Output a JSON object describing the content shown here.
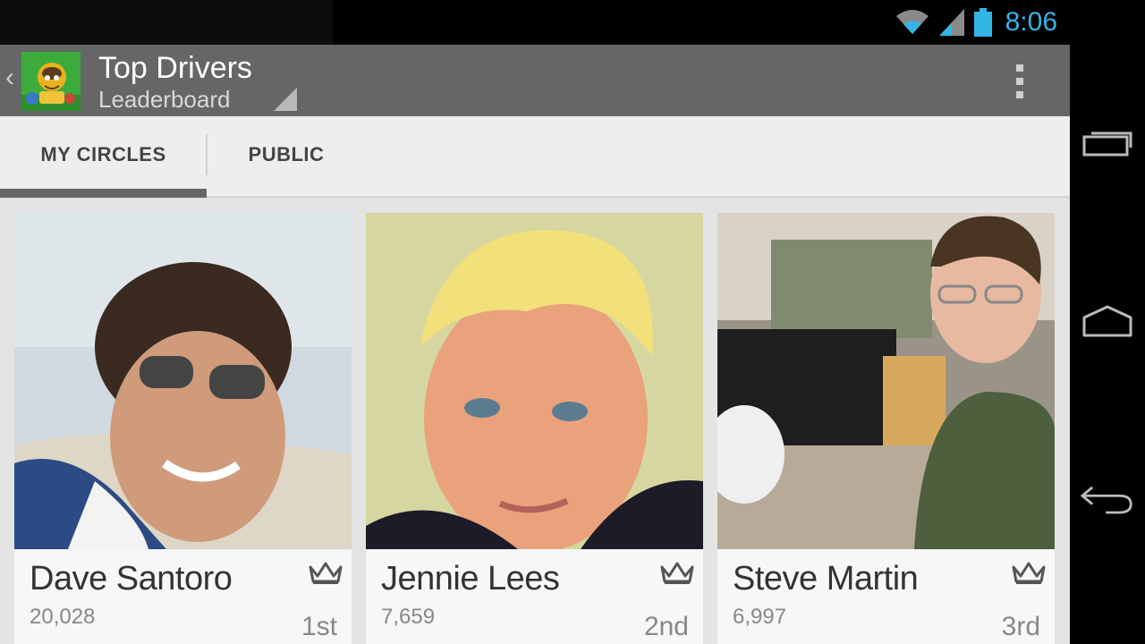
{
  "status_bar": {
    "time": "8:06"
  },
  "action_bar": {
    "title": "Top Drivers",
    "subtitle": "Leaderboard",
    "app_icon": "turtle-driver-app-icon",
    "overflow_icon": "overflow-menu-icon"
  },
  "tabs": [
    {
      "label": "MY CIRCLES",
      "selected": true
    },
    {
      "label": "PUBLIC",
      "selected": false
    }
  ],
  "leaderboard": [
    {
      "name": "Dave Santoro",
      "score": "20,028",
      "rank": "1st",
      "badge_icon": "crown-icon"
    },
    {
      "name": "Jennie Lees",
      "score": "7,659",
      "rank": "2nd",
      "badge_icon": "crown-icon"
    },
    {
      "name": "Steve Martin",
      "score": "6,997",
      "rank": "3rd",
      "badge_icon": "crown-icon"
    }
  ],
  "nav_bar": {
    "icons": [
      "recent-apps-icon",
      "home-icon",
      "back-icon"
    ]
  },
  "colors": {
    "action_bar": "#666666",
    "status_accent": "#33b5e5",
    "tab_bar": "#eeeeee",
    "tab_indicator": "#666666",
    "background": "#e4e4e4"
  }
}
